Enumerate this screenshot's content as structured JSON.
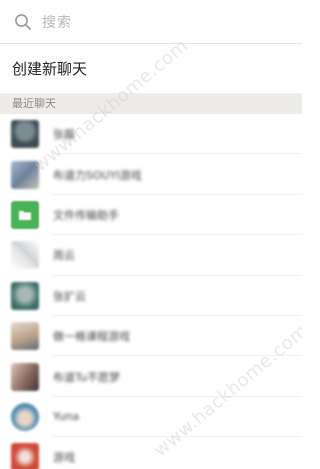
{
  "search": {
    "placeholder": "搜索",
    "icon": "search-icon"
  },
  "create_chat": {
    "label": "创建新聊天"
  },
  "recent": {
    "header": "最近聊天"
  },
  "contacts": [
    {
      "name": "张磊",
      "avatar_color": "#4a5b63"
    },
    {
      "name": "布道力SOUYI游戏",
      "avatar_color": "#7e92a8"
    },
    {
      "name": "文件传输助手",
      "avatar_color": "#49b35a"
    },
    {
      "name": "周云",
      "avatar_color": "#d9dadb"
    },
    {
      "name": "张扩云",
      "avatar_color": "#3e6e6a"
    },
    {
      "name": "做一格课程游戏",
      "avatar_color": "#c9b8a5"
    },
    {
      "name": "布道Tu不愿梦",
      "avatar_color": "#8b6a62"
    },
    {
      "name": "Yuna",
      "avatar_color": "#4f8db0"
    },
    {
      "name": "游戏",
      "avatar_color": "#cf4b39"
    }
  ],
  "watermark": "www.hackhome.com"
}
